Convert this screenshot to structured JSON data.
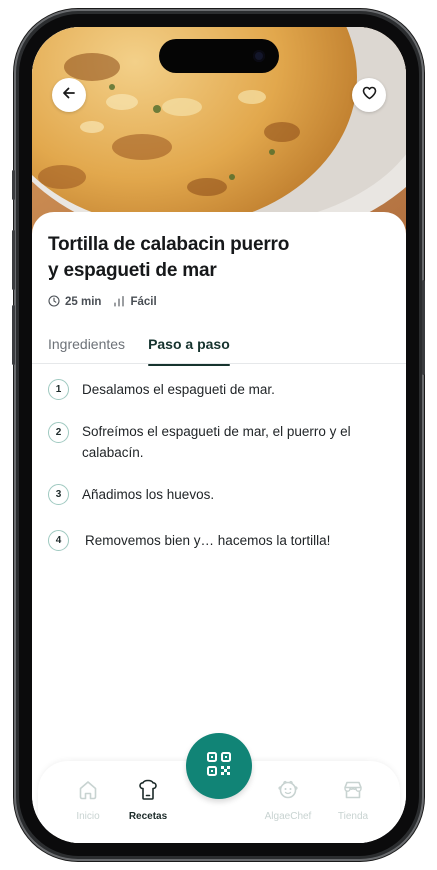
{
  "recipe": {
    "title_line1": "Tortilla de calabacin puerro",
    "title_line2": "y espagueti de mar",
    "time": "25 min",
    "difficulty": "Fácil"
  },
  "tabs": [
    {
      "label": "Ingredientes",
      "active": false
    },
    {
      "label": "Paso a paso",
      "active": true
    }
  ],
  "steps": [
    {
      "number": "1",
      "text": "Desalamos el espagueti de mar."
    },
    {
      "number": "2",
      "text": "Sofreímos el espagueti de mar, el puerro y el calabacín."
    },
    {
      "number": "3",
      "text": "Añadimos los huevos."
    },
    {
      "number": "4",
      "text": "Removemos bien y… hacemos la tortilla!"
    }
  ],
  "nav": {
    "items": [
      {
        "label": "Inicio",
        "icon": "home-icon",
        "active": false
      },
      {
        "label": "Recetas",
        "icon": "chef-hat-icon",
        "active": true
      },
      {
        "label": "AlgaeChef",
        "icon": "algae-chef-icon",
        "active": false
      },
      {
        "label": "Tienda",
        "icon": "shop-icon",
        "active": false
      }
    ],
    "fab_icon": "qr-code-icon"
  },
  "header": {
    "back_icon": "arrow-left-icon",
    "favorite_icon": "heart-icon"
  },
  "colors": {
    "accent": "#118476",
    "tab_active": "#16332e",
    "step_border": "#9fc9c0",
    "nav_inactive": "#c8d3d1"
  }
}
